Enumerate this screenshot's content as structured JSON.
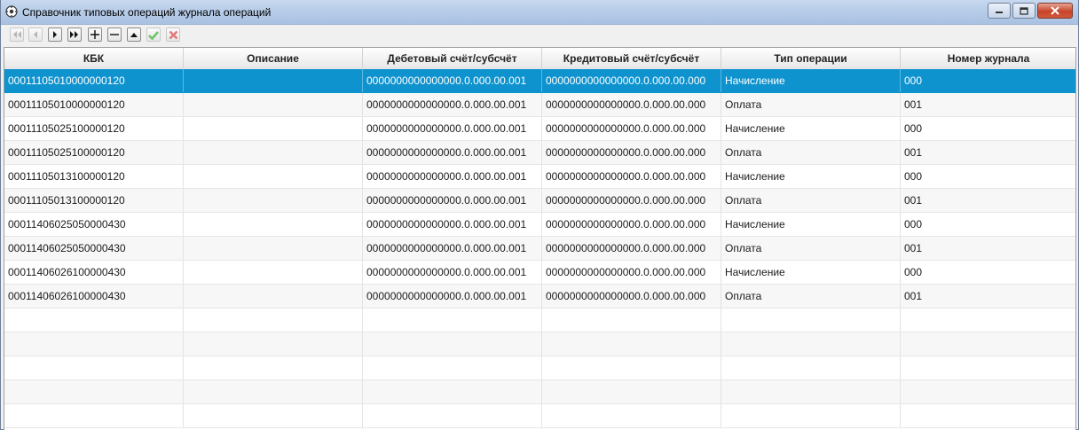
{
  "window": {
    "title": "Справочник типовых операций журнала операций"
  },
  "toolbar": {
    "buttons": [
      {
        "name": "first",
        "icon": "first-record-icon",
        "enabled": false
      },
      {
        "name": "prev",
        "icon": "prev-record-icon",
        "enabled": false
      },
      {
        "name": "next",
        "icon": "next-record-icon",
        "enabled": true
      },
      {
        "name": "last",
        "icon": "last-record-icon",
        "enabled": true
      },
      {
        "name": "add",
        "icon": "plus-icon",
        "enabled": true
      },
      {
        "name": "delete",
        "icon": "minus-icon",
        "enabled": true
      },
      {
        "name": "edit",
        "icon": "up-triangle-icon",
        "enabled": true
      },
      {
        "name": "confirm",
        "icon": "check-icon",
        "enabled": false
      },
      {
        "name": "cancel",
        "icon": "cross-icon",
        "enabled": false
      }
    ]
  },
  "colors": {
    "selected_row": "#0e93cf",
    "confirm_green": "#6fc36a",
    "cancel_red": "#e07a7a"
  },
  "table": {
    "columns": [
      "КБК",
      "Описание",
      "Дебетовый счёт/субсчёт",
      "Кредитовый счёт/субсчёт",
      "Тип операции",
      "Номер журнала"
    ],
    "selected_index": 0,
    "rows": [
      [
        "00011105010000000120",
        "",
        "0000000000000000.0.000.00.001",
        "0000000000000000.0.000.00.000",
        "Начисление",
        "000"
      ],
      [
        "00011105010000000120",
        "",
        "0000000000000000.0.000.00.001",
        "0000000000000000.0.000.00.000",
        "Оплата",
        "001"
      ],
      [
        "00011105025100000120",
        "",
        "0000000000000000.0.000.00.001",
        "0000000000000000.0.000.00.000",
        "Начисление",
        "000"
      ],
      [
        "00011105025100000120",
        "",
        "0000000000000000.0.000.00.001",
        "0000000000000000.0.000.00.000",
        "Оплата",
        "001"
      ],
      [
        "00011105013100000120",
        "",
        "0000000000000000.0.000.00.001",
        "0000000000000000.0.000.00.000",
        "Начисление",
        "000"
      ],
      [
        "00011105013100000120",
        "",
        "0000000000000000.0.000.00.001",
        "0000000000000000.0.000.00.000",
        "Оплата",
        "001"
      ],
      [
        "00011406025050000430",
        "",
        "0000000000000000.0.000.00.001",
        "0000000000000000.0.000.00.000",
        "Начисление",
        "000"
      ],
      [
        "00011406025050000430",
        "",
        "0000000000000000.0.000.00.001",
        "0000000000000000.0.000.00.000",
        "Оплата",
        "001"
      ],
      [
        "00011406026100000430",
        "",
        "0000000000000000.0.000.00.001",
        "0000000000000000.0.000.00.000",
        "Начисление",
        "000"
      ],
      [
        "00011406026100000430",
        "",
        "0000000000000000.0.000.00.001",
        "0000000000000000.0.000.00.000",
        "Оплата",
        "001"
      ]
    ],
    "empty_rows": 5
  }
}
